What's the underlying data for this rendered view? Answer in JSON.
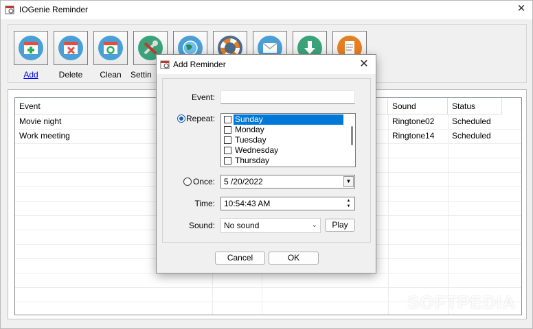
{
  "window": {
    "title": "IOGenie Reminder",
    "close_symbol": "✕"
  },
  "toolbar": {
    "buttons": [
      {
        "name": "add",
        "label": "Add",
        "icon": "calendar-add-icon"
      },
      {
        "name": "delete",
        "label": "Delete",
        "icon": "calendar-delete-icon"
      },
      {
        "name": "clean",
        "label": "Clean",
        "icon": "calendar-recycle-icon"
      },
      {
        "name": "settings",
        "label": "Settin",
        "icon": "tools-icon"
      },
      {
        "name": "web",
        "label": "",
        "icon": "globe-icon"
      },
      {
        "name": "help",
        "label": "",
        "icon": "lifebuoy-icon"
      },
      {
        "name": "mail",
        "label": "",
        "icon": "mail-icon"
      },
      {
        "name": "download",
        "label": "",
        "icon": "download-icon"
      },
      {
        "name": "about",
        "label": "",
        "icon": "document-icon"
      }
    ]
  },
  "table": {
    "columns": [
      "Event",
      "",
      "",
      "Sound",
      "Status"
    ],
    "rows": [
      {
        "event": "Movie night",
        "sound": "Ringtone02",
        "status": "Scheduled"
      },
      {
        "event": "Work meeting",
        "sound": "Ringtone14",
        "status": "Scheduled"
      }
    ]
  },
  "watermark": "SOFTPEDIA",
  "dialog": {
    "title": "Add Reminder",
    "close_symbol": "✕",
    "event_label": "Event:",
    "event_value": "",
    "repeat_label": "Repeat:",
    "days": [
      "Sunday",
      "Monday",
      "Tuesday",
      "Wednesday",
      "Thursday"
    ],
    "selected_day": "Sunday",
    "once_label": "Once:",
    "once_date": "5 /20/2022",
    "time_label": "Time:",
    "time_value": "10:54:43 AM",
    "sound_label": "Sound:",
    "sound_value": "No sound",
    "play_label": "Play",
    "cancel_label": "Cancel",
    "ok_label": "OK",
    "mode": "repeat"
  },
  "colors": {
    "accent": "#0078d7",
    "link": "#0000ee"
  }
}
